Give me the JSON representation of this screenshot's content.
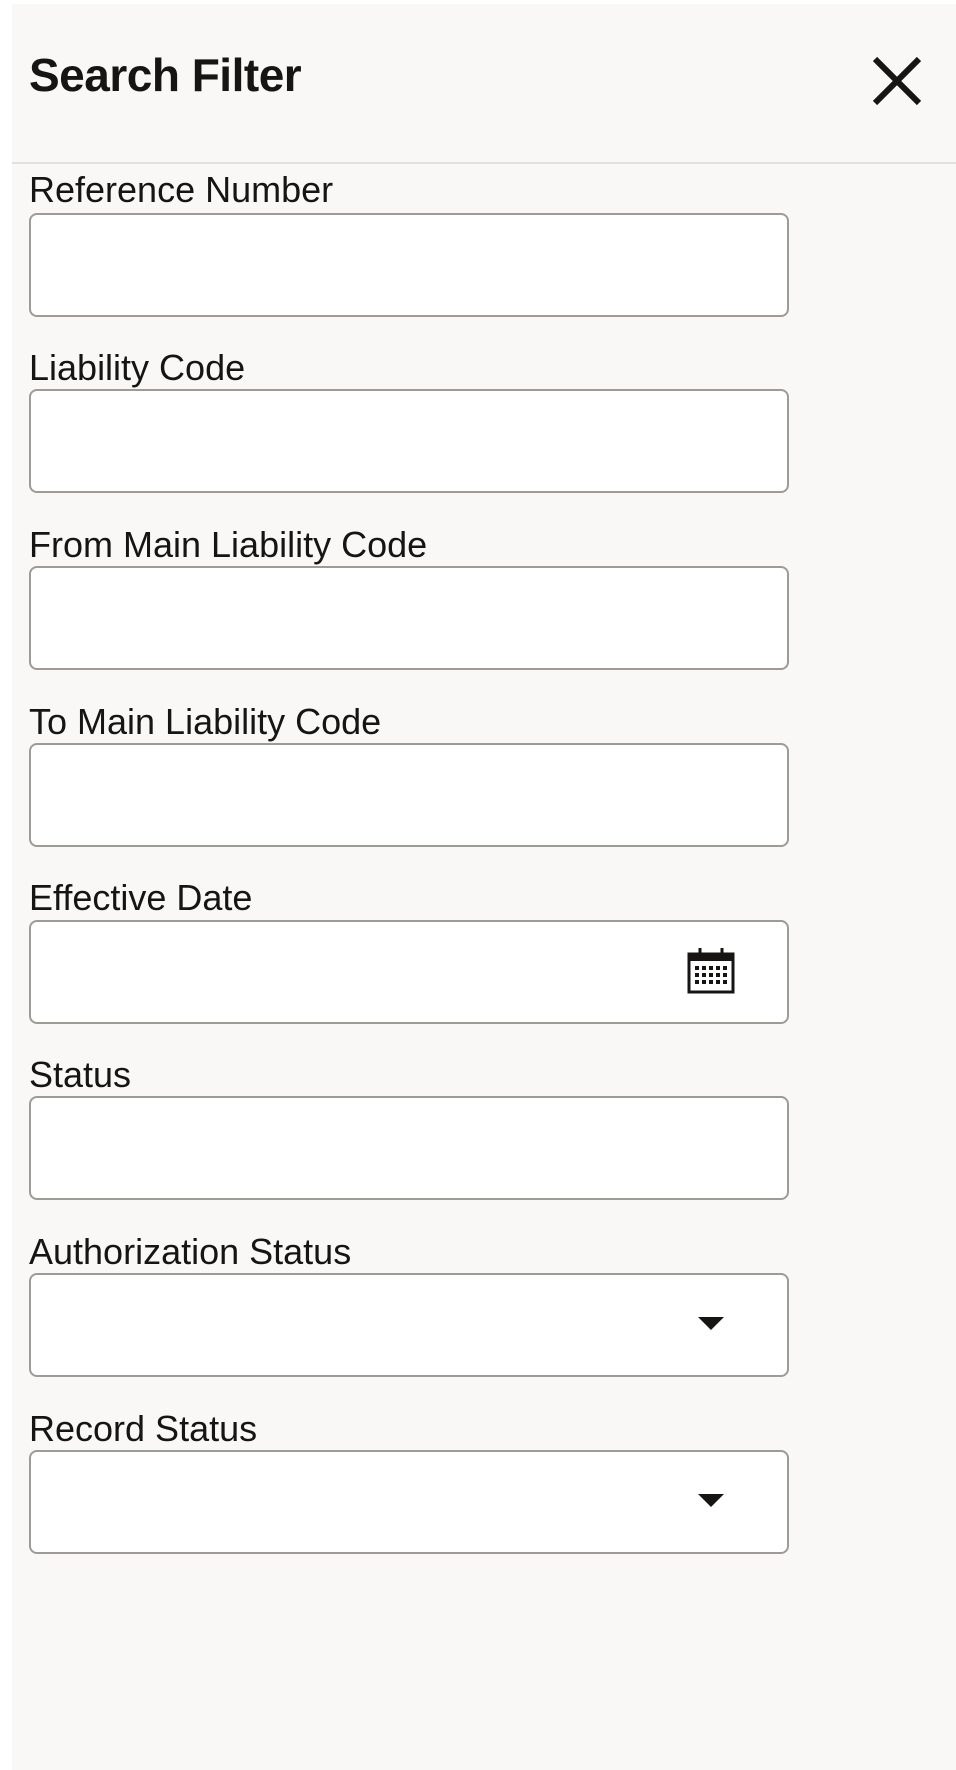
{
  "header": {
    "title": "Search Filter",
    "close_icon": "close-icon"
  },
  "fields": {
    "reference_number": {
      "label": "Reference Number",
      "value": "",
      "placeholder": ""
    },
    "liability_code": {
      "label": "Liability Code",
      "value": "",
      "placeholder": ""
    },
    "from_main_liability_code": {
      "label": "From Main Liability Code",
      "value": "",
      "placeholder": ""
    },
    "to_main_liability_code": {
      "label": "To Main Liability Code",
      "value": "",
      "placeholder": ""
    },
    "effective_date": {
      "label": "Effective Date",
      "value": "",
      "placeholder": "",
      "icon": "calendar-icon"
    },
    "status": {
      "label": "Status",
      "value": "",
      "placeholder": ""
    },
    "authorization_status": {
      "label": "Authorization Status",
      "selected": "",
      "icon": "caret-down-icon"
    },
    "record_status": {
      "label": "Record Status",
      "selected": "",
      "icon": "caret-down-icon"
    }
  },
  "colors": {
    "panel_background": "#f9f8f7",
    "input_background": "#ffffff",
    "input_border": "#9e9b97",
    "text": "#161513",
    "divider": "#e4e2df"
  }
}
